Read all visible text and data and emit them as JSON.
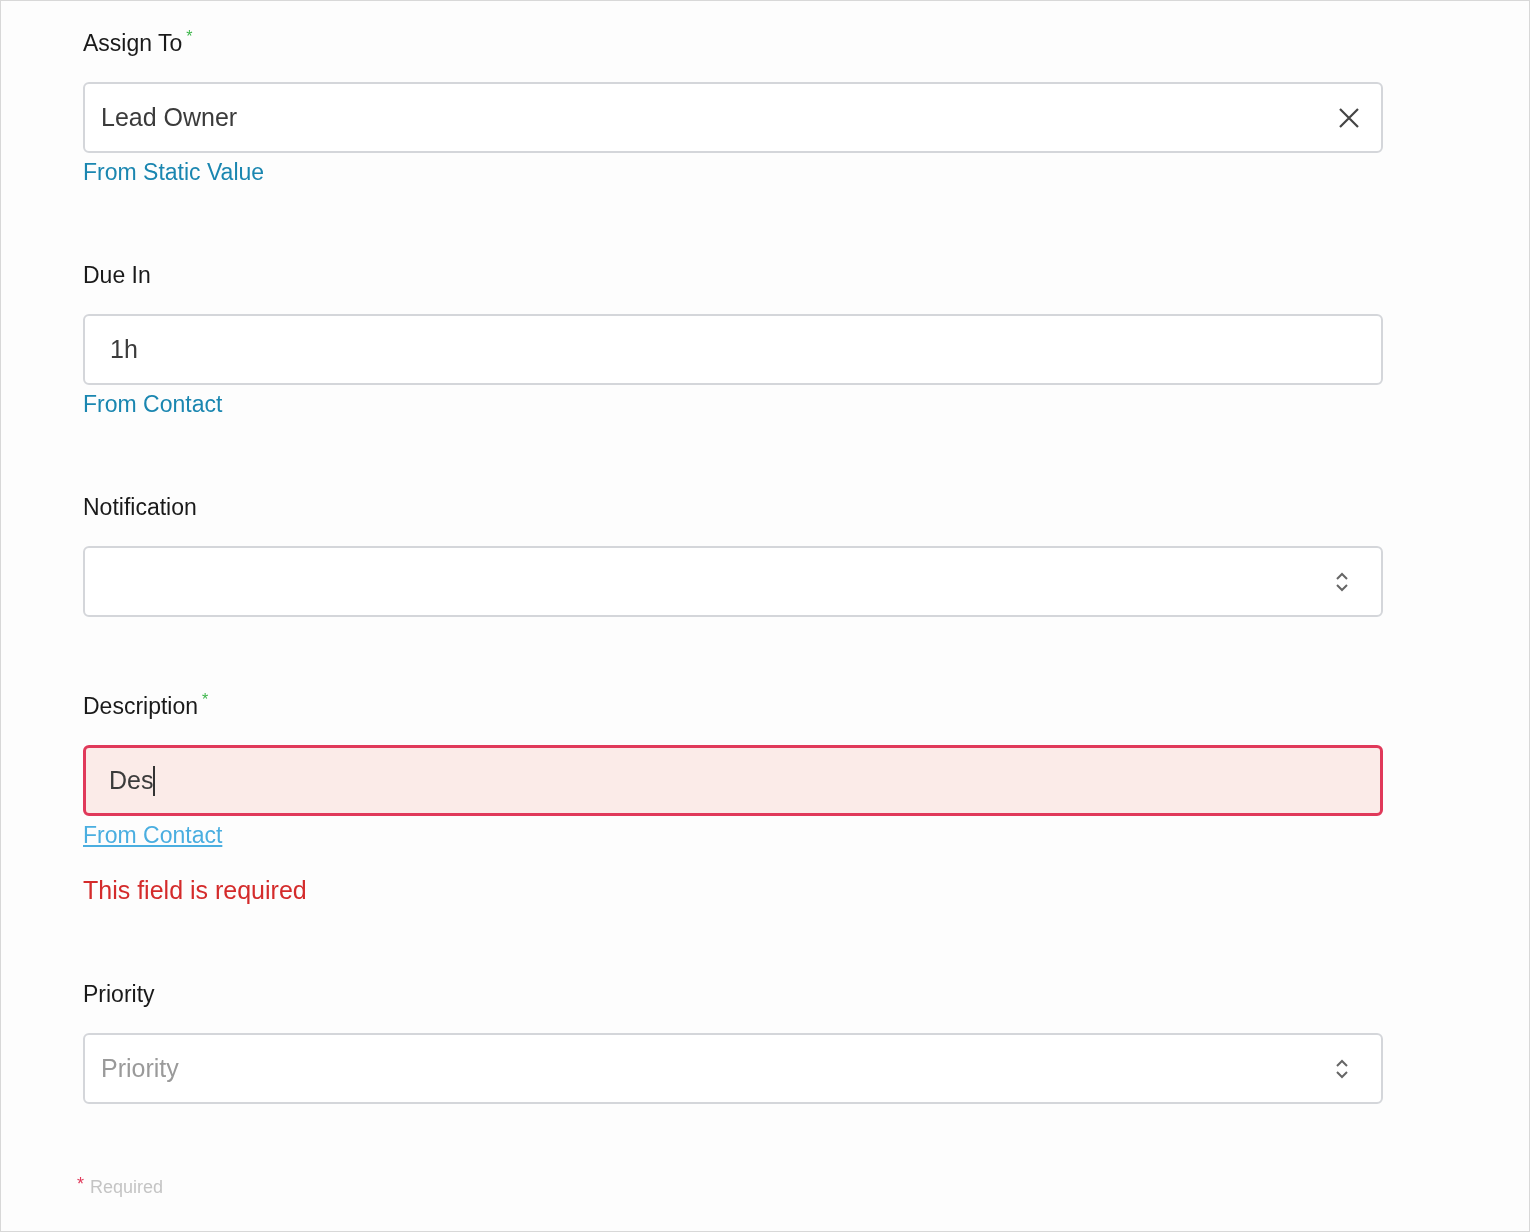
{
  "fields": [
    {
      "kind": "clearable",
      "label": "Assign To",
      "required": true,
      "value": "Lead Owner",
      "link": {
        "text": "From Static Value",
        "hovered": false
      },
      "invalid": false
    },
    {
      "kind": "text",
      "label": "Due In",
      "required": false,
      "value": "1h",
      "link": {
        "text": "From Contact",
        "hovered": false
      },
      "invalid": false
    },
    {
      "kind": "select",
      "label": "Notification",
      "required": false,
      "invalid": false
    },
    {
      "kind": "text",
      "label": "Description",
      "required": true,
      "value": "Des",
      "focused": true,
      "link": {
        "text": "From Contact",
        "hovered": true
      },
      "invalid": true,
      "error": "This field is required"
    },
    {
      "kind": "select",
      "label": "Priority",
      "required": false,
      "placeholder": "Priority",
      "invalid": false
    }
  ],
  "footer": {
    "mark": "*",
    "text": "Required"
  }
}
